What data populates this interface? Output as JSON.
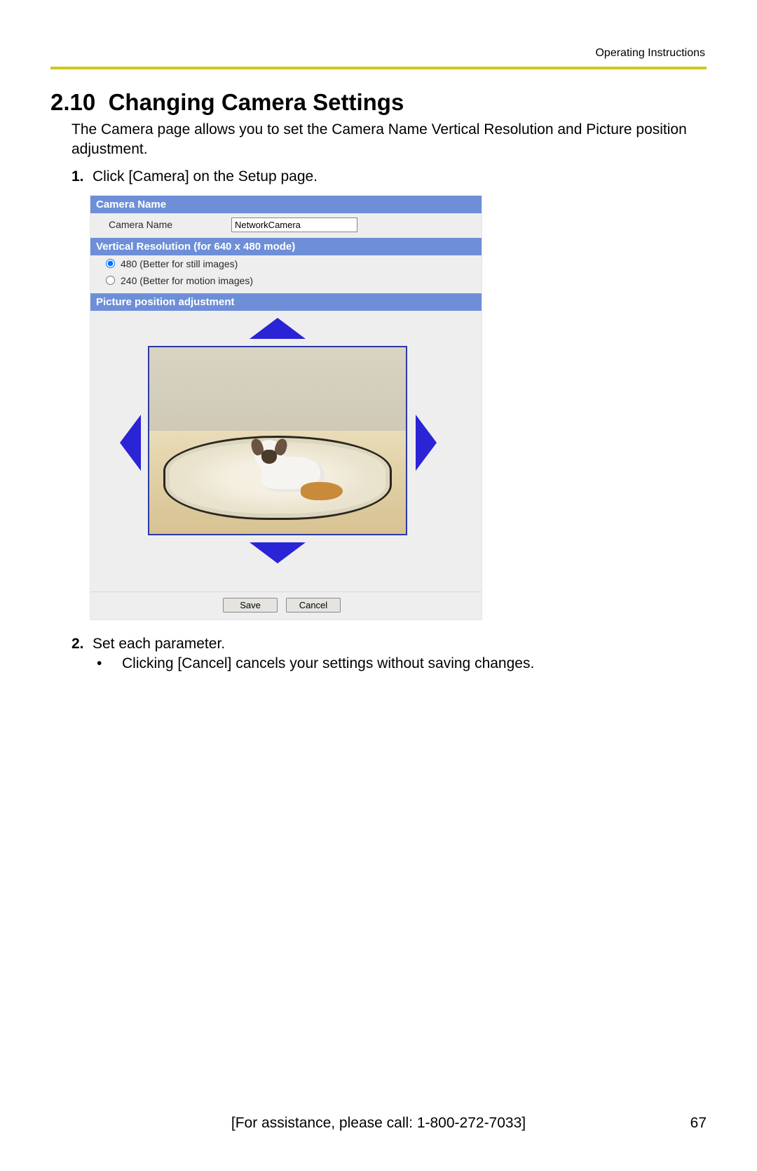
{
  "header_label": "Operating Instructions",
  "section_number": "2.10",
  "section_title": "Changing Camera Settings",
  "intro": "The Camera page allows you to set the Camera Name Vertical Resolution and Picture position adjustment.",
  "steps": {
    "s1_num": "1.",
    "s1_text": "Click [Camera] on the Setup page.",
    "s2_num": "2.",
    "s2_text": "Set each parameter.",
    "s2_bullet": "Clicking [Cancel] cancels your settings without saving changes."
  },
  "panel": {
    "camera_name_header": "Camera Name",
    "camera_name_label": "Camera Name",
    "camera_name_value": "NetworkCamera",
    "vres_header": "Vertical Resolution (for 640 x 480 mode)",
    "vres_option_480": "480 (Better for still images)",
    "vres_option_240": "240 (Better for motion images)",
    "vres_selected": "480",
    "picpos_header": "Picture position adjustment",
    "save_label": "Save",
    "cancel_label": "Cancel"
  },
  "footer": {
    "assist": "[For assistance, please call: 1-800-272-7033]",
    "page_number": "67"
  },
  "colors": {
    "rule": "#d3c817",
    "panel_header": "#6e8fd8",
    "arrow": "#2b23d6"
  }
}
